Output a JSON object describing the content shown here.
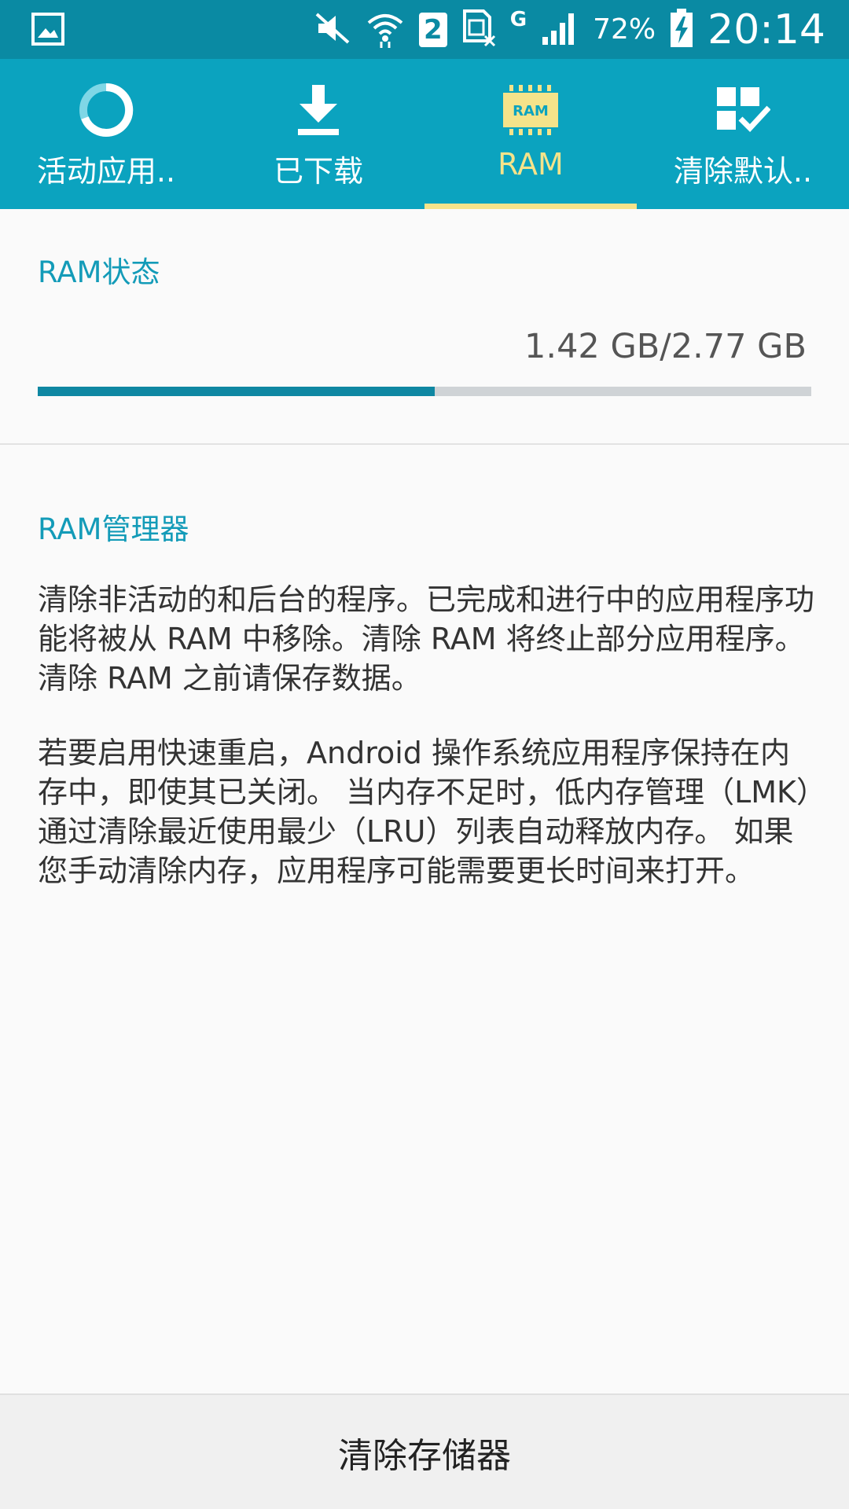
{
  "status_bar": {
    "battery_percent": "72%",
    "time": "20:14",
    "sim_badge": "2",
    "network_type": "G"
  },
  "tabs": [
    {
      "label": "活动应用..",
      "icon": "progress-ring-icon",
      "active": false
    },
    {
      "label": "已下载",
      "icon": "download-icon",
      "active": false
    },
    {
      "label": "RAM",
      "icon": "ram-chip-icon",
      "icon_text": "RAM",
      "active": true
    },
    {
      "label": "清除默认..",
      "icon": "clear-defaults-icon",
      "active": false
    }
  ],
  "ram_status": {
    "title": "RAM状态",
    "usage_text": "1.42 GB/2.77 GB",
    "used_fraction": 0.513
  },
  "ram_manager": {
    "title": "RAM管理器",
    "paragraph1": "清除非活动的和后台的程序。已完成和进行中的应用程序功能将被从 RAM 中移除。清除 RAM 将终止部分应用程序。清除 RAM 之前请保存数据。",
    "paragraph2": "若要启用快速重启，Android 操作系统应用程序保持在内存中，即使其已关闭。 当内存不足时，低内存管理（LMK）通过清除最近使用最少（LRU）列表自动释放内存。 如果您手动清除内存，应用程序可能需要更长时间来打开。"
  },
  "clear_button": {
    "label": "清除存储器"
  },
  "colors": {
    "status_bar": "#0a8aa3",
    "tab_bar": "#0ba3bf",
    "accent_yellow": "#f5e38a",
    "section_title": "#139bb8",
    "progress_fill": "#0f87a2",
    "progress_track": "#cfd3d6"
  }
}
